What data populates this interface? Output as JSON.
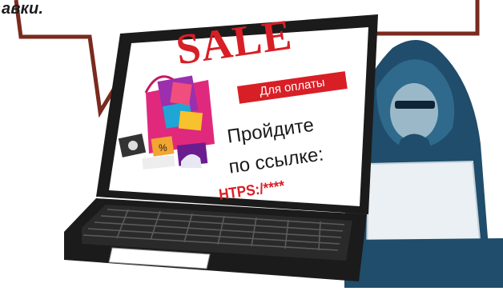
{
  "speech_bubble": {
    "text": "авки."
  },
  "screen": {
    "sale_title": "SALE",
    "pay_banner": "Для оплаты",
    "instruction_line1": "Пройдите",
    "instruction_line2": "по ссылке:",
    "link": "HTPS:/****"
  },
  "colors": {
    "accent_red": "#d81f26",
    "bubble_outline": "#7a2a1e",
    "laptop_dark": "#1b1b1b",
    "hacker_blue": "#1f4d6b",
    "hoodie_light": "#3a6f90"
  }
}
